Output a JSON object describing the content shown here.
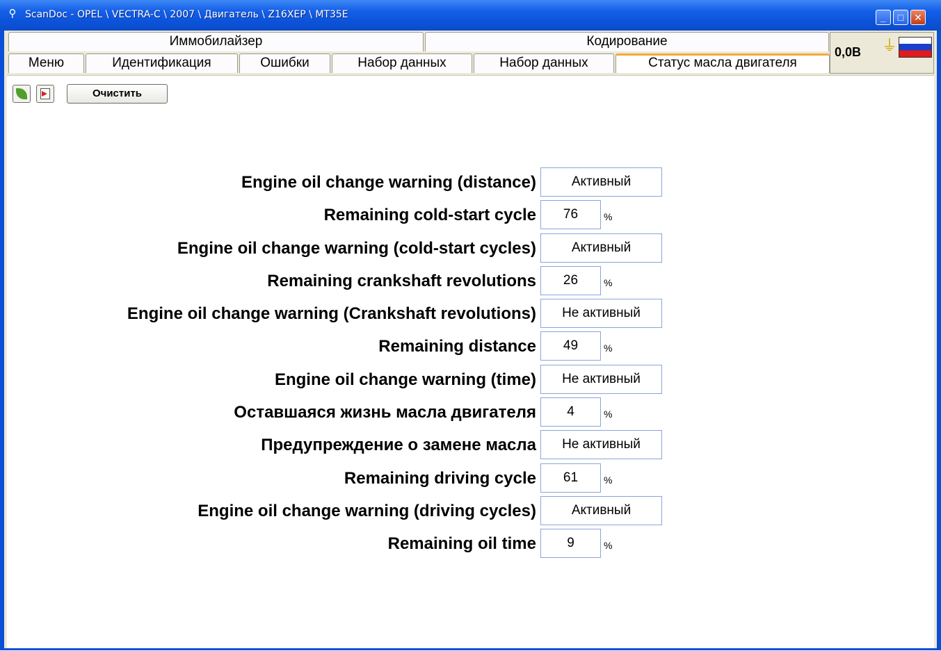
{
  "window": {
    "title": "ScanDoc - OPEL \\ VECTRA-C \\ 2007 \\ Двигатель \\ Z16XEP \\ MT35E"
  },
  "tabs_row1": [
    {
      "label": "Иммобилайзер"
    },
    {
      "label": "Кодирование"
    }
  ],
  "tabs_row2": [
    {
      "label": "Меню"
    },
    {
      "label": "Идентификация"
    },
    {
      "label": "Ошибки"
    },
    {
      "label": "Набор данных"
    },
    {
      "label": "Набор данных"
    },
    {
      "label": "Статус масла двигателя",
      "active": true
    }
  ],
  "status": {
    "voltage": "0,0В"
  },
  "toolbar": {
    "clear_label": "Очистить"
  },
  "params": [
    {
      "label": "Engine oil change warning (distance)",
      "value": "Активный",
      "unit": ""
    },
    {
      "label": "Remaining cold-start cycle",
      "value": "76",
      "unit": "%"
    },
    {
      "label": "Engine oil change warning (cold-start cycles)",
      "value": "Активный",
      "unit": ""
    },
    {
      "label": "Remaining crankshaft revolutions",
      "value": "26",
      "unit": "%"
    },
    {
      "label": "Engine oil change warning (Crankshaft revolutions)",
      "value": "Не активный",
      "unit": ""
    },
    {
      "label": "Remaining distance",
      "value": "49",
      "unit": "%"
    },
    {
      "label": "Engine oil change warning (time)",
      "value": "Не активный",
      "unit": ""
    },
    {
      "label": "Оставшаяся жизнь масла двигателя",
      "value": "4",
      "unit": "%"
    },
    {
      "label": "Предупреждение о замене масла",
      "value": "Не активный",
      "unit": ""
    },
    {
      "label": "Remaining driving cycle",
      "value": "61",
      "unit": "%"
    },
    {
      "label": "Engine oil change warning (driving cycles)",
      "value": "Активный",
      "unit": ""
    },
    {
      "label": "Remaining oil time",
      "value": "9",
      "unit": "%"
    }
  ],
  "colors": {
    "titlebar": "#0c53d9",
    "active_tab_accent": "#f6a93a",
    "field_border": "#8aa4d6"
  }
}
